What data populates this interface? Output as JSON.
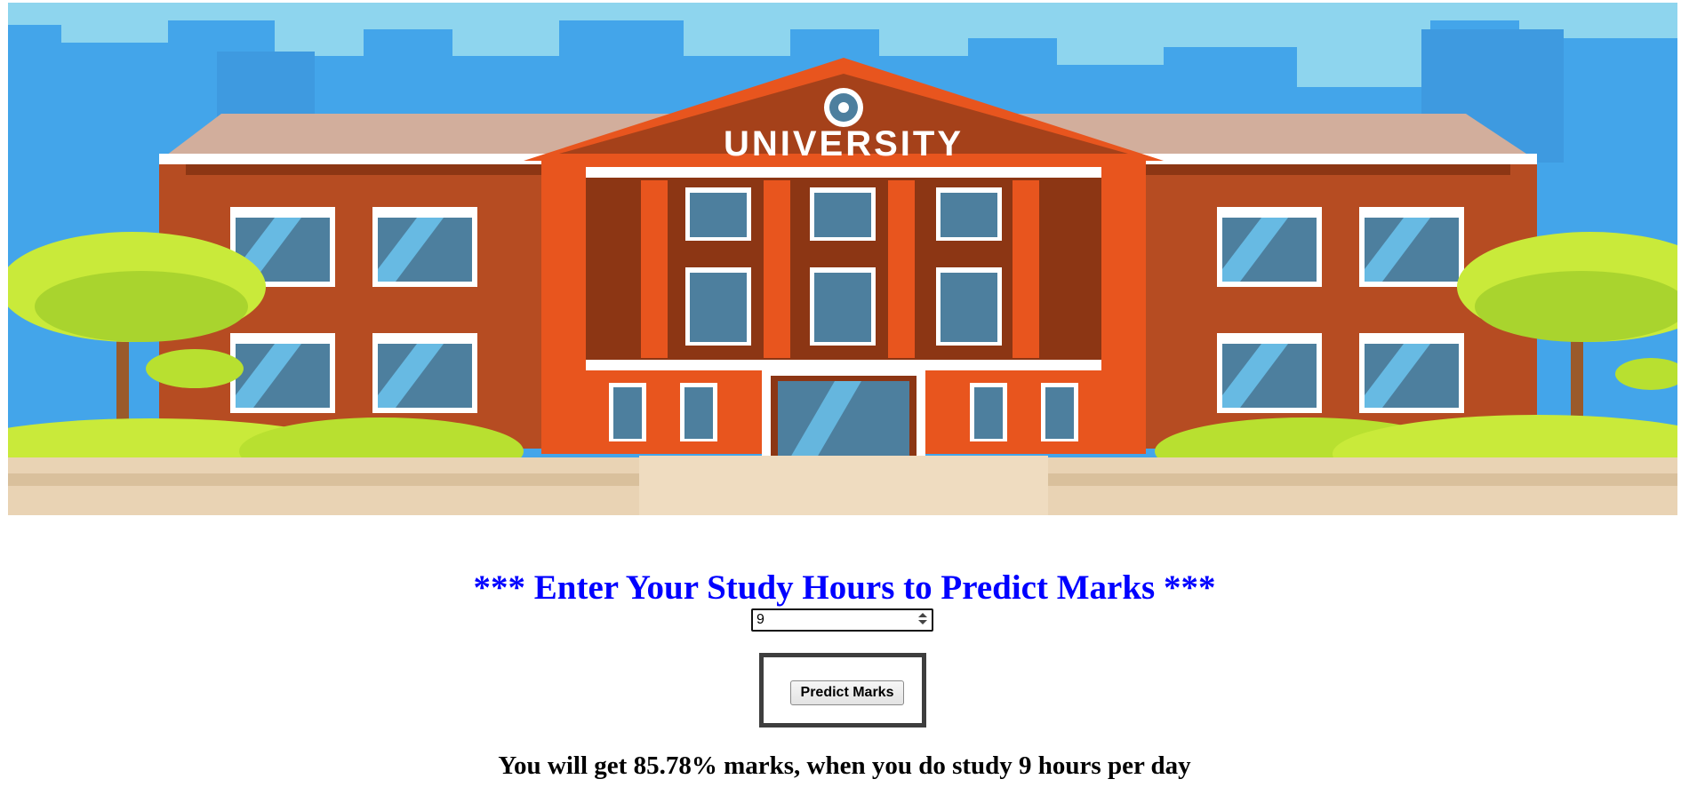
{
  "banner": {
    "sign_text": "UNIVERSITY",
    "colors": {
      "sky": "#43a5ea",
      "skyline": "#8ed5ee",
      "roof": "#d2ae9c",
      "brick": "#b64c22",
      "brick_dark": "#8c3614",
      "accent": "#e8551e",
      "window": "#4d7f9e",
      "glass": "#6cc4ee",
      "tree": "#b8e030",
      "ground": "#e9d3b4"
    }
  },
  "heading": "*** Enter Your Study Hours to Predict Marks ***",
  "hours_input": {
    "value": "9",
    "icon": "spinner-arrows-icon"
  },
  "predict_button": {
    "label": "Predict Marks"
  },
  "result_text": "You will get 85.78% marks, when you do study 9 hours per day"
}
